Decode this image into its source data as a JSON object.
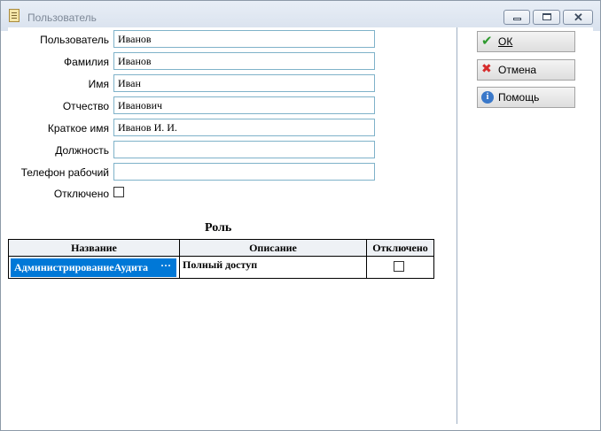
{
  "window": {
    "title": "Пользователь"
  },
  "fields": [
    {
      "label": "Пользователь",
      "value": "Иванов"
    },
    {
      "label": "Фамилия",
      "value": "Иванов"
    },
    {
      "label": "Имя",
      "value": "Иван"
    },
    {
      "label": "Отчество",
      "value": "Иванович"
    },
    {
      "label": "Краткое имя",
      "value": "Иванов И. И."
    },
    {
      "label": "Должность",
      "value": ""
    },
    {
      "label": "Телефон рабочий",
      "value": ""
    }
  ],
  "disabled": {
    "label": "Отключено",
    "checked": false
  },
  "roles": {
    "title": "Роль",
    "columns": [
      "Название",
      "Описание",
      "Отключено"
    ],
    "rows": [
      {
        "name": "АдминистрированиеАудита",
        "description": "Полный доступ",
        "disabled": false,
        "ellipsis": "···"
      }
    ]
  },
  "buttons": {
    "ok": "ОК",
    "cancel": "Отмена",
    "help": "Помощь"
  },
  "icons": {
    "help_glyph": "i"
  }
}
